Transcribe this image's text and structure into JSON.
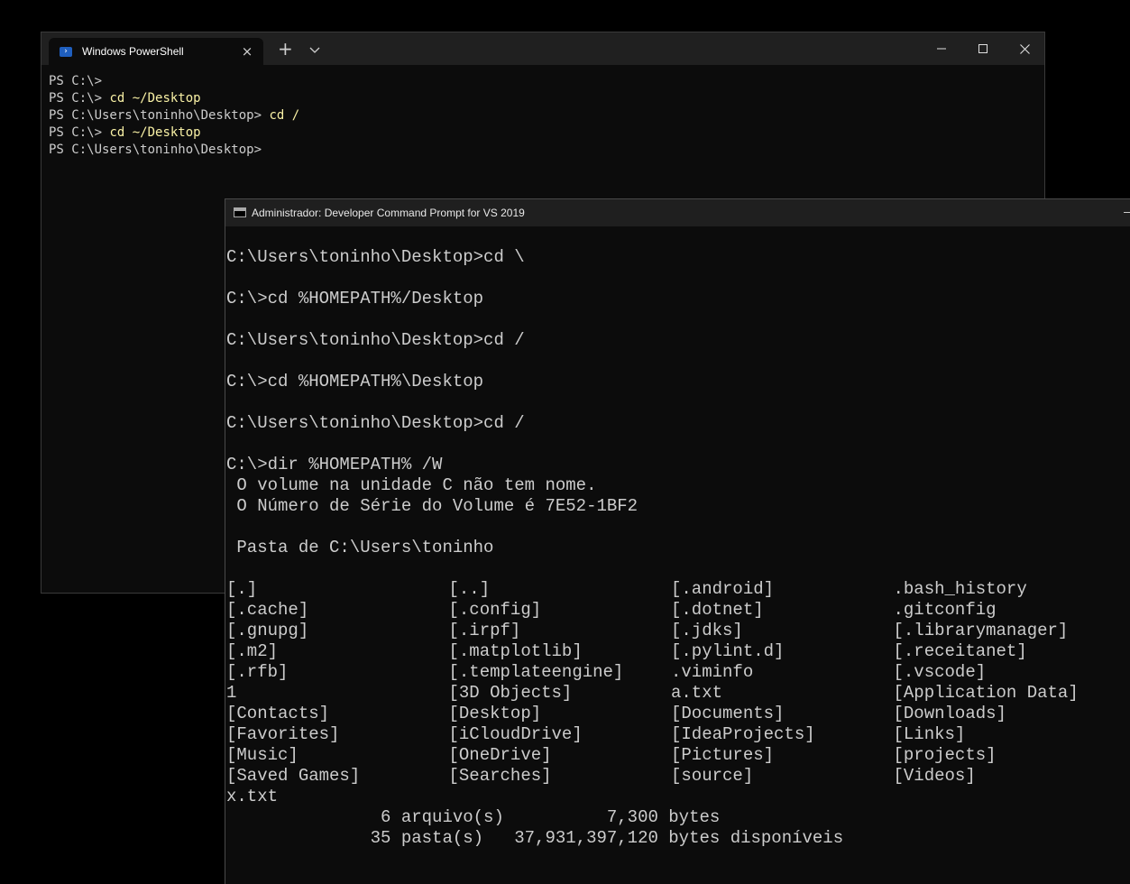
{
  "powershell": {
    "tab_title": "Windows PowerShell",
    "icons": {
      "tab_icon": "powershell-icon",
      "close": "close-icon",
      "new_tab": "plus-icon",
      "dropdown": "chevron-down-icon"
    },
    "window_controls": {
      "minimize": "minimize-icon",
      "maximize": "maximize-icon",
      "close": "close-icon"
    },
    "colors": {
      "command": "#f9f1a5",
      "text": "#cccccc",
      "background": "#0c0c0c"
    },
    "lines": [
      {
        "prompt": "PS C:\\> ",
        "cmd": ""
      },
      {
        "prompt": "PS C:\\> ",
        "cmd": "cd ~/Desktop"
      },
      {
        "prompt": "PS C:\\Users\\toninho\\Desktop> ",
        "cmd": "cd /"
      },
      {
        "prompt": "PS C:\\> ",
        "cmd": "cd ~/Desktop"
      },
      {
        "prompt": "PS C:\\Users\\toninho\\Desktop> ",
        "cmd": ""
      }
    ]
  },
  "cmd": {
    "title": "Administrador: Developer Command Prompt for VS 2019",
    "icon": "console-icon",
    "lines_before": [
      "C:\\Users\\toninho\\Desktop>cd \\",
      "",
      "C:\\>cd %HOMEPATH%/Desktop",
      "",
      "C:\\Users\\toninho\\Desktop>cd /",
      "",
      "C:\\>cd %HOMEPATH%\\Desktop",
      "",
      "C:\\Users\\toninho\\Desktop>cd /",
      "",
      "C:\\>dir %HOMEPATH% /W",
      " O volume na unidade C não tem nome.",
      " O Número de Série do Volume é 7E52-1BF2",
      "",
      " Pasta de C:\\Users\\toninho",
      ""
    ],
    "dir_entries": [
      "[.]",
      "[..]",
      "[.android]",
      ".bash_history",
      "[.cache]",
      "[.config]",
      "[.dotnet]",
      ".gitconfig",
      "[.gnupg]",
      "[.irpf]",
      "[.jdks]",
      "[.librarymanager]",
      "[.m2]",
      "[.matplotlib]",
      "[.pylint.d]",
      "[.receitanet]",
      "[.rfb]",
      "[.templateengine]",
      ".viminfo",
      "[.vscode]",
      "1",
      "[3D Objects]",
      "a.txt",
      "[Application Data]",
      "[Contacts]",
      "[Desktop]",
      "[Documents]",
      "[Downloads]",
      "[Favorites]",
      "[iCloudDrive]",
      "[IdeaProjects]",
      "[Links]",
      "[Music]",
      "[OneDrive]",
      "[Pictures]",
      "[projects]",
      "[Saved Games]",
      "[Searches]",
      "[source]",
      "[Videos]",
      "x.txt"
    ],
    "lines_after": [
      "               6 arquivo(s)          7,300 bytes",
      "              35 pasta(s)   37,931,397,120 bytes disponíveis"
    ]
  }
}
